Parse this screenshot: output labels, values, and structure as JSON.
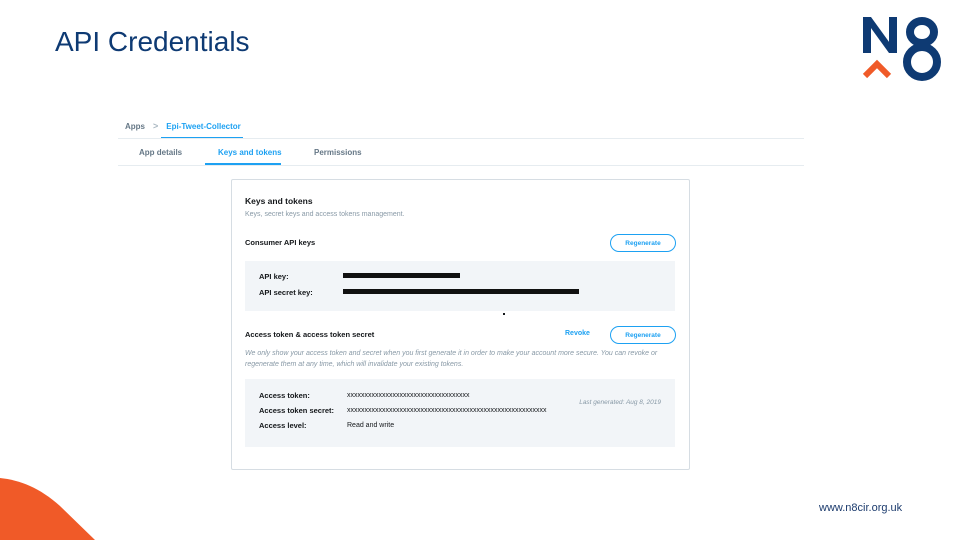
{
  "slide": {
    "title": "API Credentials",
    "footer_url": "www.n8cir.org.uk"
  },
  "colors": {
    "title": "#0e3a73",
    "logo_blue": "#0e3a73",
    "logo_orange": "#f05a28",
    "accent": "#1da1f2"
  },
  "breadcrumb": {
    "apps": "Apps",
    "separator": ">",
    "app_name": "Epi-Tweet-Collector"
  },
  "tabs": [
    {
      "label": "App details",
      "active": false
    },
    {
      "label": "Keys and tokens",
      "active": true
    },
    {
      "label": "Permissions",
      "active": false
    }
  ],
  "card": {
    "title": "Keys and tokens",
    "subtitle": "Keys, secret keys and access tokens management.",
    "consumer": {
      "title": "Consumer API keys",
      "regenerate_label": "Regenerate",
      "api_key_label": "API key:",
      "api_secret_label": "API secret key:"
    },
    "access": {
      "title": "Access token & access token secret",
      "revoke_label": "Revoke",
      "regenerate_label": "Regenerate",
      "note": "We only show your access token and secret when you first generate it in order to make your account more secure. You can revoke or regenerate them at any time, which will invalidate your existing tokens.",
      "rows": [
        {
          "label": "Access token:",
          "value": "xxxxxxxxxxxxxxxxxxxxxxxxxxxxxxxxxxx"
        },
        {
          "label": "Access token secret:",
          "value": "xxxxxxxxxxxxxxxxxxxxxxxxxxxxxxxxxxxxxxxxxxxxxxxxxxxxxxxxx"
        },
        {
          "label": "Access level:",
          "value": "Read and write"
        }
      ],
      "last_generated": "Last generated: Aug 8, 2019"
    }
  }
}
